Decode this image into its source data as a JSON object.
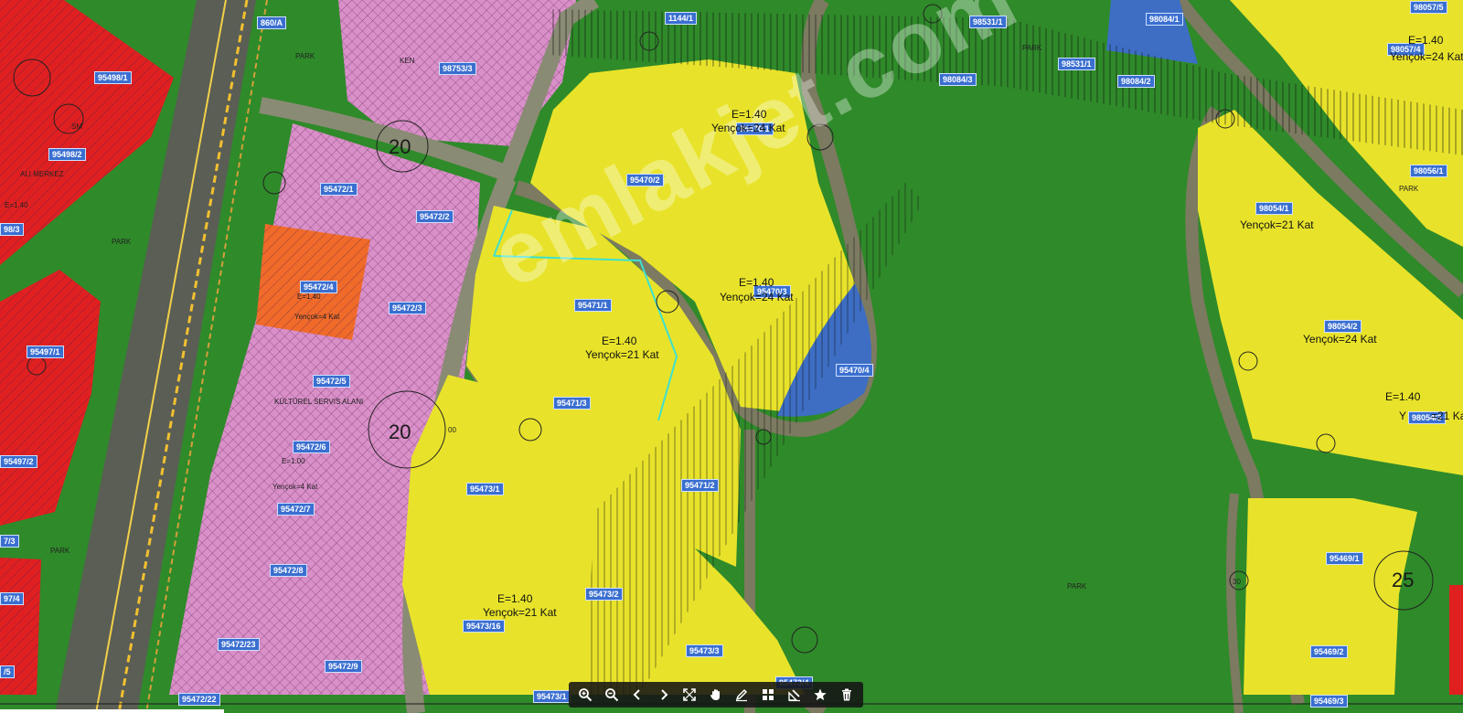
{
  "map": {
    "watermark": "emlakjet.com",
    "parcel_labels": [
      "95498/1",
      "95498/2",
      "98/3",
      "95497/1",
      "95497/2",
      "7/3",
      "97/4",
      "/5",
      "98753/3",
      "95472/1",
      "95472/2",
      "95472/4",
      "95472/3",
      "95472/5",
      "95472/6",
      "95472/7",
      "95472/8",
      "95472/23",
      "95472/9",
      "95472/22",
      "95470/2",
      "95470/1",
      "95470/3",
      "95470/4",
      "95471/1",
      "95471/3",
      "95471/2",
      "95473/1",
      "95473/2",
      "95473/16",
      "95473/3",
      "95473/4",
      "95473/1",
      "1144/1",
      "98531/1",
      "98531/1",
      "98084/3",
      "98084/2",
      "98084/1",
      "98057/5",
      "98057/4",
      "98056/1",
      "98054/1",
      "98054/2",
      "98054/3",
      "95469/1",
      "95469/2",
      "95469/3",
      "860/A"
    ],
    "zone_texts": [
      "E=1.40",
      "Yençok=24 Kat",
      "E=1.40",
      "Yençok=24 Kat",
      "E=1.40",
      "Yençok=21 Kat",
      "E=1.40",
      "Yençok=21 Kat",
      "E=1.40",
      "Yençok=24 Kat",
      "Yençok=21 Kat",
      "Yençok=24 Kat",
      "E=1.40",
      "Y",
      "=21 Kat"
    ],
    "area_texts": [
      "PARK",
      "PARK",
      "PARK",
      "PARK",
      "PARK",
      "PARK",
      "SM"
    ],
    "small_texts": [
      "E=1.40",
      "Yençok=4 Kat",
      "KÜLTÜREL SERVIS ALANI",
      "E=1.00",
      "Yençok=4 Kat",
      "KEN",
      "ALI MERKEZ",
      "E=1.40"
    ],
    "block_numbers": [
      "20",
      "20",
      "25",
      "00",
      "30"
    ]
  },
  "toolbar": {
    "buttons": [
      {
        "name": "zoom-in-button",
        "icon": "zoom-in-icon"
      },
      {
        "name": "zoom-out-button",
        "icon": "zoom-out-icon"
      },
      {
        "name": "back-button",
        "icon": "chevron-left-icon"
      },
      {
        "name": "forward-button",
        "icon": "chevron-right-icon"
      },
      {
        "name": "fullscreen-button",
        "icon": "expand-icon"
      },
      {
        "name": "pan-button",
        "icon": "hand-icon"
      },
      {
        "name": "draw-button",
        "icon": "pencil-icon"
      },
      {
        "name": "layers-button",
        "icon": "grid-icon"
      },
      {
        "name": "measure-button",
        "icon": "ruler-icon"
      },
      {
        "name": "favorite-button",
        "icon": "star-icon"
      },
      {
        "name": "delete-button",
        "icon": "trash-icon"
      }
    ]
  },
  "colors": {
    "park": "#2f8a2a",
    "residential": "#e8e32a",
    "commercial_pink": "#d98fc8",
    "commercial_red": "#e02020",
    "orange": "#f06a2a",
    "blue": "#3d6ec4",
    "road": "#6b6f5a"
  }
}
